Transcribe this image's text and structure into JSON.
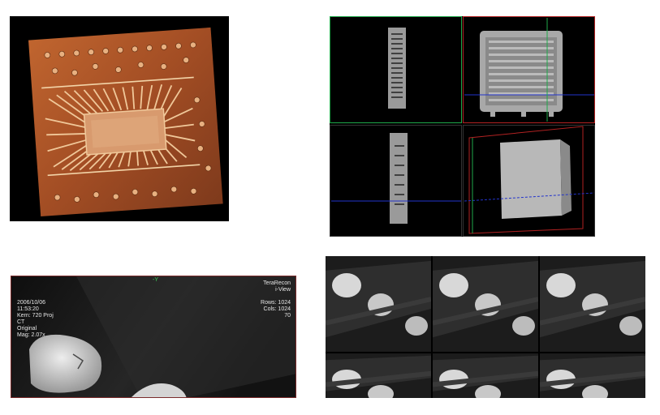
{
  "panels": {
    "render_3d": {
      "name": "3D volume render of chip"
    },
    "mpr": {
      "name": "multi-planar reconstruction"
    },
    "ct_slice": {
      "orientation": "-Y",
      "date": "2006/10/06",
      "time": "11:53:20",
      "kern": "Kern: 720 Proj",
      "modality": "CT",
      "image_type": "Original",
      "mag": "Mag: 2.07x",
      "vendor": "TeraRecon",
      "app": "i-View",
      "rows": "Rows: 1024",
      "cols": "Cols: 1024",
      "slice_num": "70"
    },
    "grid": {
      "columns": 3,
      "rows": 2,
      "selected_cell": 0
    }
  },
  "colors": {
    "selection": "#c0392b",
    "crosshair_green": "#1fa84a",
    "crosshair_blue": "#2233cc",
    "crosshair_red": "#b22222"
  }
}
